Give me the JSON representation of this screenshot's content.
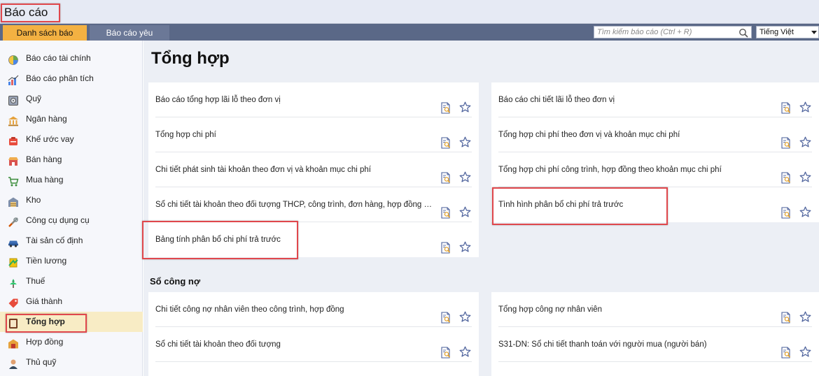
{
  "window": {
    "title": "Báo cáo"
  },
  "tabs": [
    {
      "label": "Danh sách báo cáo",
      "active": true
    },
    {
      "label": "Báo cáo yêu thích",
      "active": false
    }
  ],
  "search": {
    "placeholder": "Tìm kiếm báo cáo (Ctrl + R)",
    "value": ""
  },
  "language": {
    "selected": "Tiếng Việt"
  },
  "sidebar": {
    "items": [
      {
        "label": "Báo cáo tài chính",
        "icon": "pie-chart-icon"
      },
      {
        "label": "Báo cáo phân tích",
        "icon": "bar-chart-icon"
      },
      {
        "label": "Quỹ",
        "icon": "safe-icon"
      },
      {
        "label": "Ngân hàng",
        "icon": "bank-icon"
      },
      {
        "label": "Khế ước vay",
        "icon": "loan-icon"
      },
      {
        "label": "Bán hàng",
        "icon": "shop-icon"
      },
      {
        "label": "Mua hàng",
        "icon": "cart-icon"
      },
      {
        "label": "Kho",
        "icon": "warehouse-icon"
      },
      {
        "label": "Công cụ dụng cụ",
        "icon": "tools-icon"
      },
      {
        "label": "Tài sản cố định",
        "icon": "car-icon"
      },
      {
        "label": "Tiền lương",
        "icon": "salary-icon"
      },
      {
        "label": "Thuế",
        "icon": "tax-icon"
      },
      {
        "label": "Giá thành",
        "icon": "price-tag-icon"
      },
      {
        "label": "Tổng hợp",
        "icon": "book-icon",
        "active": true
      },
      {
        "label": "Hợp đồng",
        "icon": "contract-icon"
      },
      {
        "label": "Thủ quỹ",
        "icon": "cashier-icon"
      }
    ]
  },
  "main": {
    "title": "Tổng hợp",
    "left_reports": [
      "Báo cáo tổng hợp lãi lỗ theo đơn vị",
      "Tổng hợp chi phí",
      "Chi tiết phát sinh tài khoản theo đơn vị và khoản mục chi phí",
      "Sổ chi tiết tài khoản theo đối tượng THCP, công trình, đơn hàng, hợp đồng và...",
      "Bảng tính phân bổ chi phí trả trước"
    ],
    "right_reports": [
      "Báo cáo chi tiết lãi lỗ theo đơn vị",
      "Tổng hợp chi phí theo đơn vị và khoản mục chi phí",
      "Tổng hợp chi phí công trình, hợp đồng theo khoản mục chi phí",
      "Tình hình phân bổ chi phí trả trước"
    ],
    "section2": {
      "title": "Sổ công nợ",
      "left_reports": [
        "Chi tiết công nợ nhân viên theo công trình, hợp đồng",
        "Sổ chi tiết tài khoản theo đối tượng"
      ],
      "right_reports": [
        "Tổng hợp công nợ nhân viên",
        "S31-DN: Sổ chi tiết thanh toán với người mua (người bán)"
      ]
    }
  },
  "colors": {
    "tab_active": "#f3b142",
    "tabbar": "#5a6887",
    "highlight_box": "#e0474c",
    "sidebar_active": "#f8ecc5",
    "star": "#4a5f9a"
  }
}
